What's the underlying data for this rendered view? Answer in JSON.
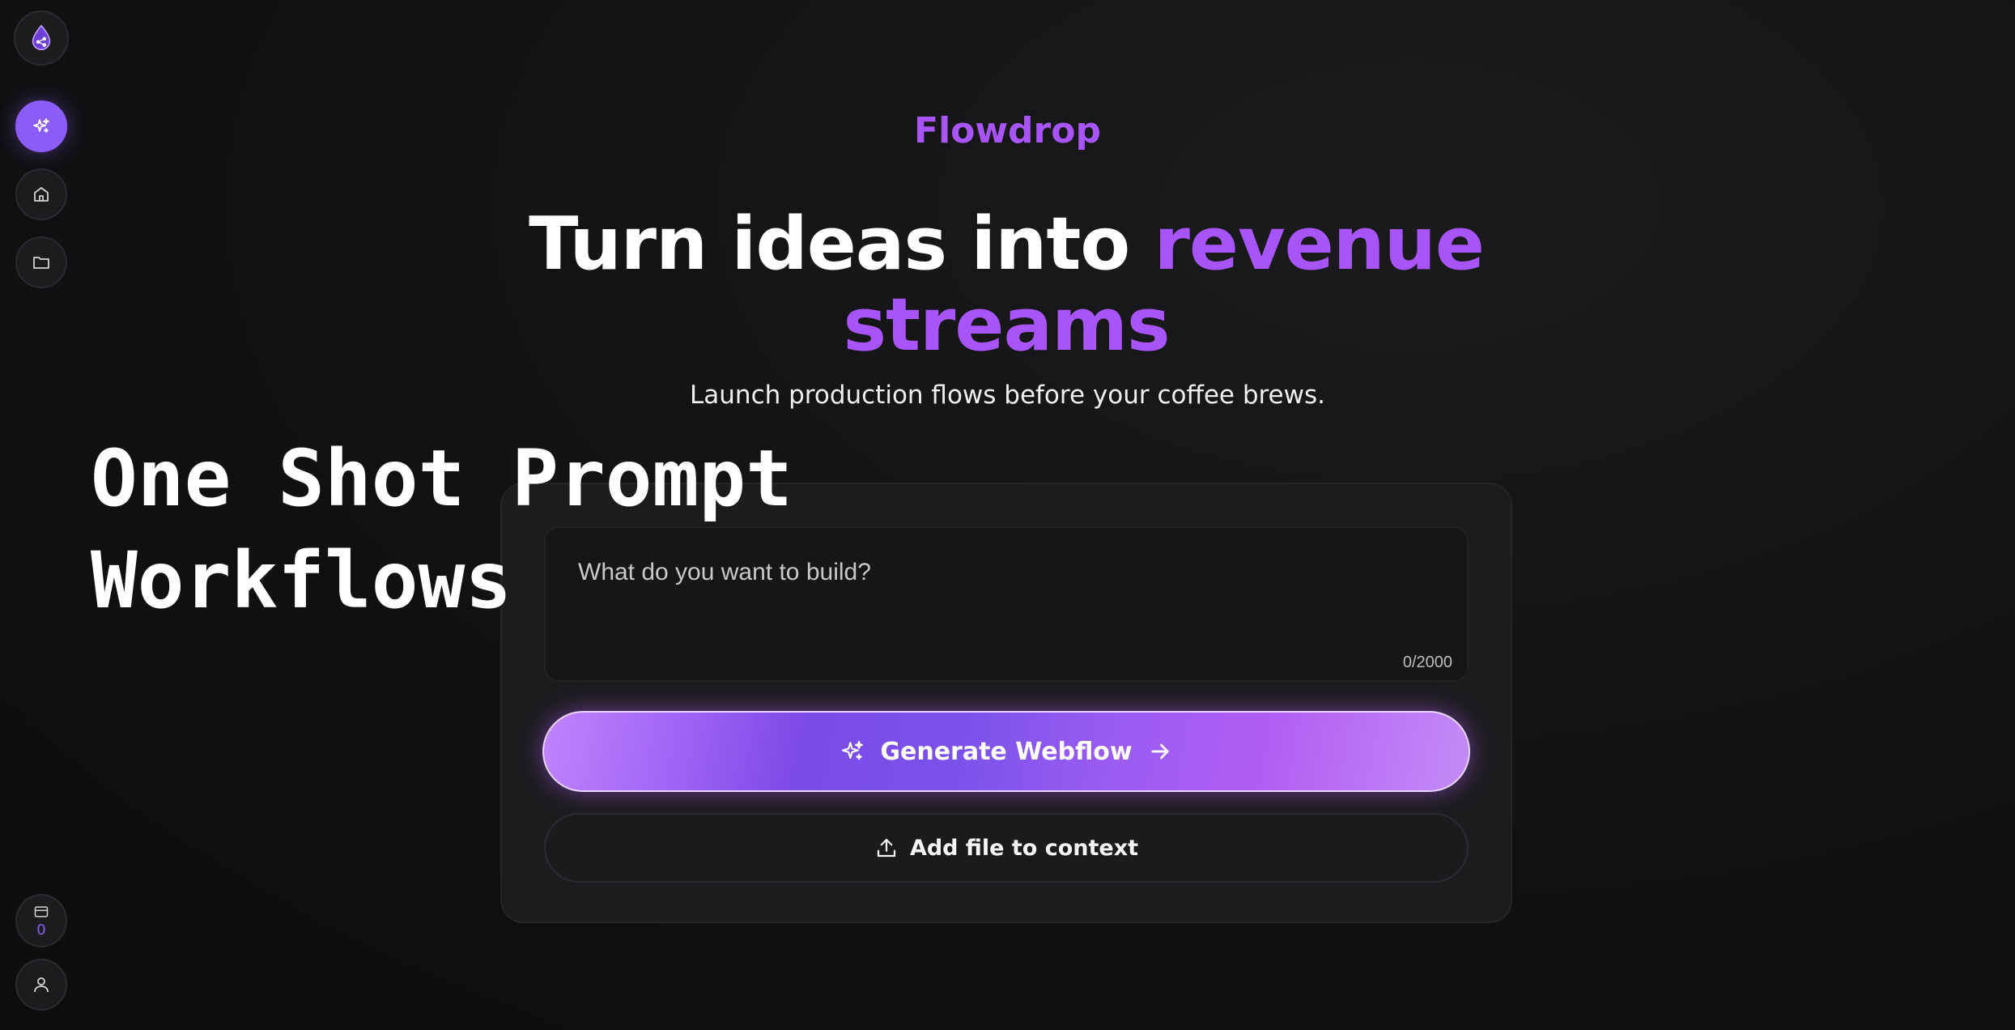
{
  "brand": {
    "name": "Flowdrop"
  },
  "hero": {
    "headline_plain": "Turn ideas into ",
    "headline_accent_1": "revenue",
    "headline_accent_2": "streams",
    "subtitle": "Launch production flows before your coffee brews."
  },
  "overlay": {
    "line1": "One Shot Prompt",
    "line2": "Workflows"
  },
  "prompt": {
    "placeholder": "What do you want to build?",
    "value": "",
    "char_count": "0/2000"
  },
  "actions": {
    "generate_label": "Generate Webflow",
    "add_file_label": "Add file to context"
  },
  "sidebar": {
    "logo_icon": "drop-logo-icon",
    "items": [
      {
        "icon": "sparkles-icon",
        "active": true
      },
      {
        "icon": "home-icon",
        "active": false
      },
      {
        "icon": "folder-icon",
        "active": false
      }
    ],
    "credits": {
      "icon": "credit-card-icon",
      "count": "0"
    },
    "user_icon": "user-icon"
  },
  "colors": {
    "accent": "#a855f7",
    "accent_active": "#8b5cf6",
    "background": "#111113",
    "card": "#1c1c1e"
  }
}
